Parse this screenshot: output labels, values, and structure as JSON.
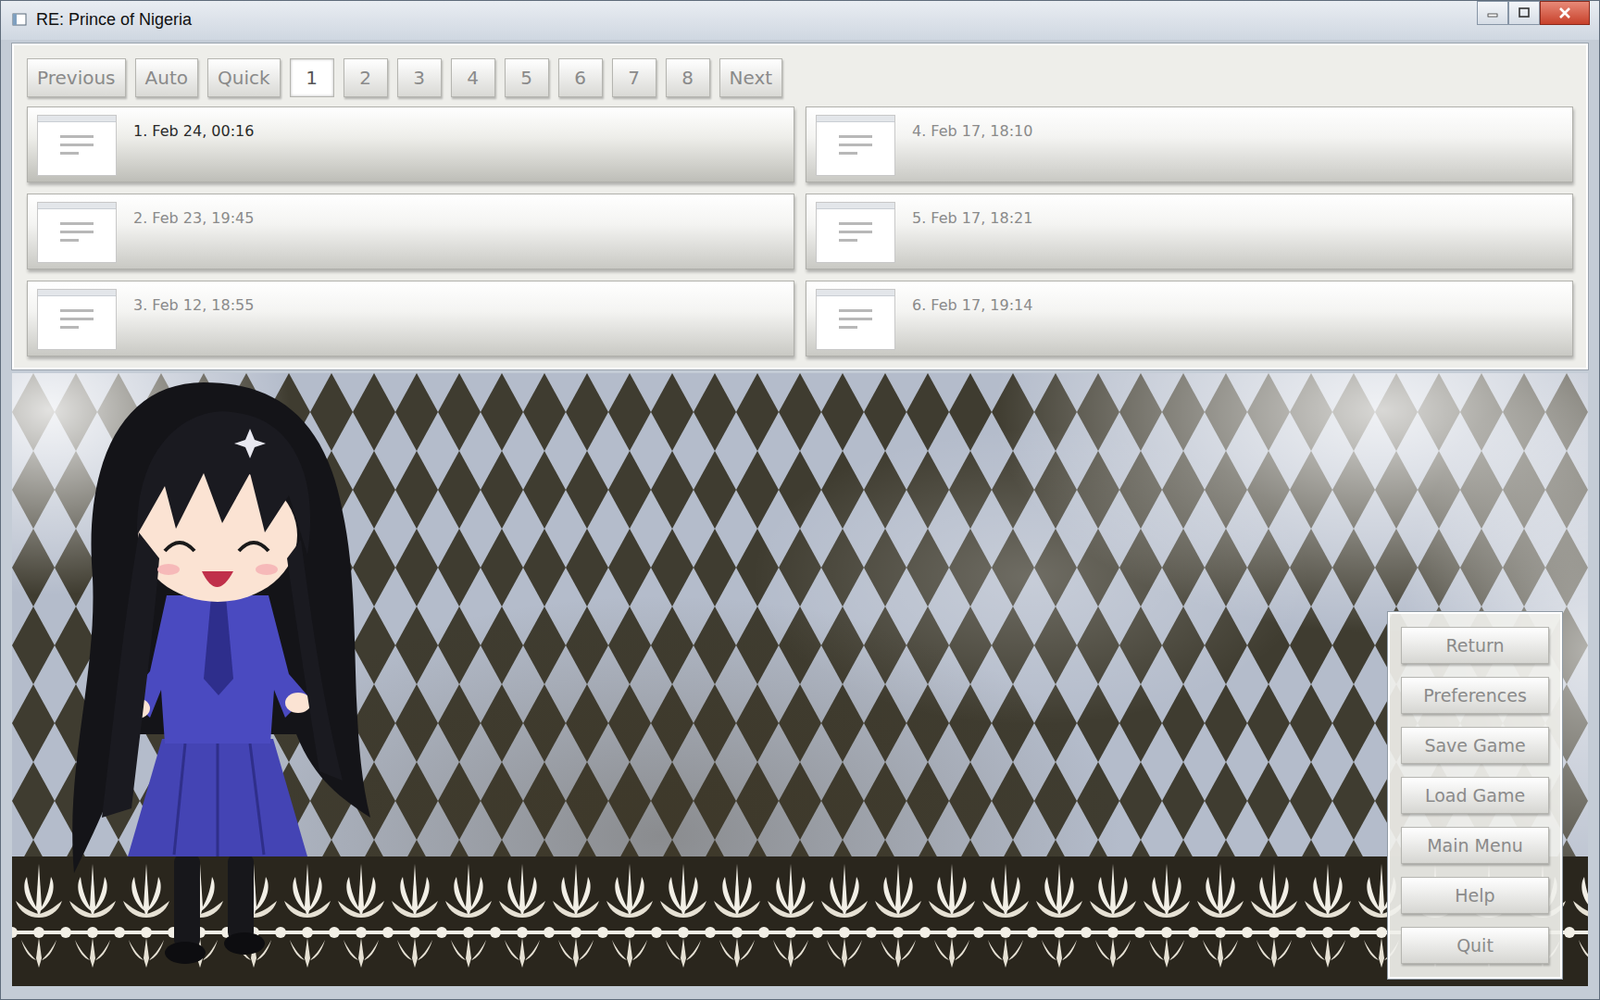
{
  "window": {
    "title": "RE: Prince of Nigeria"
  },
  "pager": [
    {
      "label": "Previous",
      "selected": false
    },
    {
      "label": "Auto",
      "selected": false
    },
    {
      "label": "Quick",
      "selected": false
    },
    {
      "label": "1",
      "selected": true
    },
    {
      "label": "2",
      "selected": false
    },
    {
      "label": "3",
      "selected": false
    },
    {
      "label": "4",
      "selected": false
    },
    {
      "label": "5",
      "selected": false
    },
    {
      "label": "6",
      "selected": false
    },
    {
      "label": "7",
      "selected": false
    },
    {
      "label": "8",
      "selected": false
    },
    {
      "label": "Next",
      "selected": false
    }
  ],
  "slots": [
    {
      "label": "1. Feb 24, 00:16",
      "selected": true
    },
    {
      "label": "2. Feb 23, 19:45",
      "selected": false
    },
    {
      "label": "3. Feb 12, 18:55",
      "selected": false
    },
    {
      "label": "4. Feb 17, 18:10",
      "selected": false
    },
    {
      "label": "5. Feb 17, 18:21",
      "selected": false
    },
    {
      "label": "6. Feb 17, 19:14",
      "selected": false
    }
  ],
  "menu": [
    "Return",
    "Preferences",
    "Save Game",
    "Load Game",
    "Main Menu",
    "Help",
    "Quit"
  ]
}
